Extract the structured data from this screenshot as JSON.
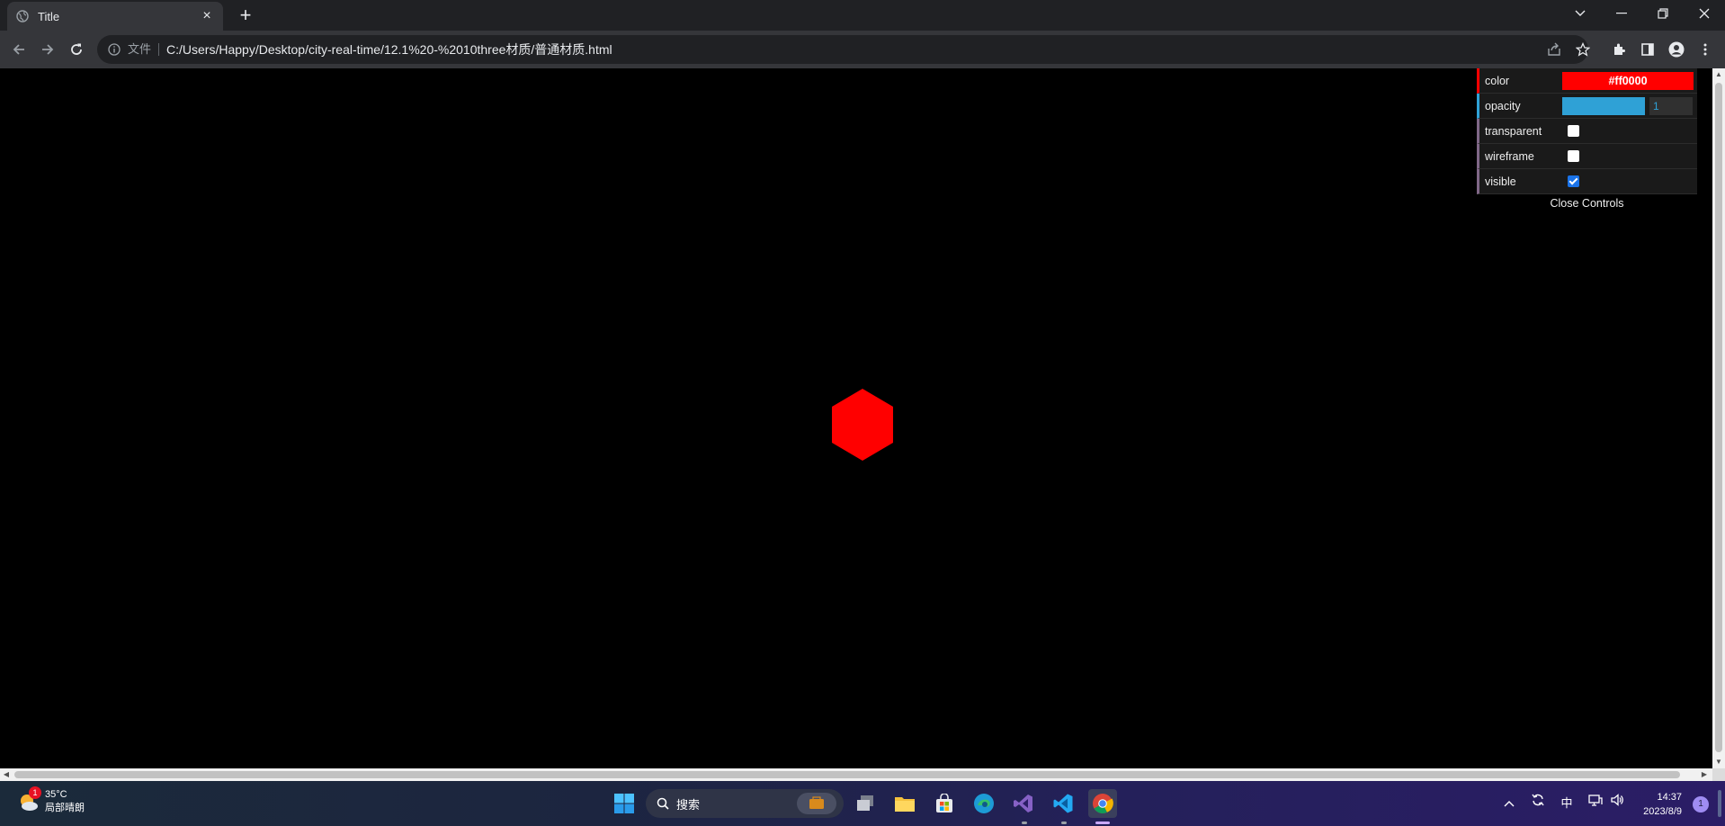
{
  "browser": {
    "tab_title": "Title",
    "tab_close": "×",
    "new_tab": "+",
    "file_label": "文件",
    "url": "C:/Users/Happy/Desktop/city-real-time/12.1%20-%2010three材质/普通材质.html"
  },
  "gui": {
    "color_label": "color",
    "color_value": "#ff0000",
    "opacity_label": "opacity",
    "opacity_value": "1",
    "opacity_fraction": 1,
    "transparent_label": "transparent",
    "transparent_checked": false,
    "wireframe_label": "wireframe",
    "wireframe_checked": false,
    "visible_label": "visible",
    "visible_checked": true,
    "close_label": "Close Controls"
  },
  "scene": {
    "mesh_color": "#ff0000",
    "background": "#000000"
  },
  "taskbar": {
    "temperature": "35°C",
    "weather": "局部晴朗",
    "weather_badge": "1",
    "search_placeholder": "搜索",
    "ime": "中",
    "time": "14:37",
    "date": "2023/8/9",
    "notification_count": "1"
  }
}
